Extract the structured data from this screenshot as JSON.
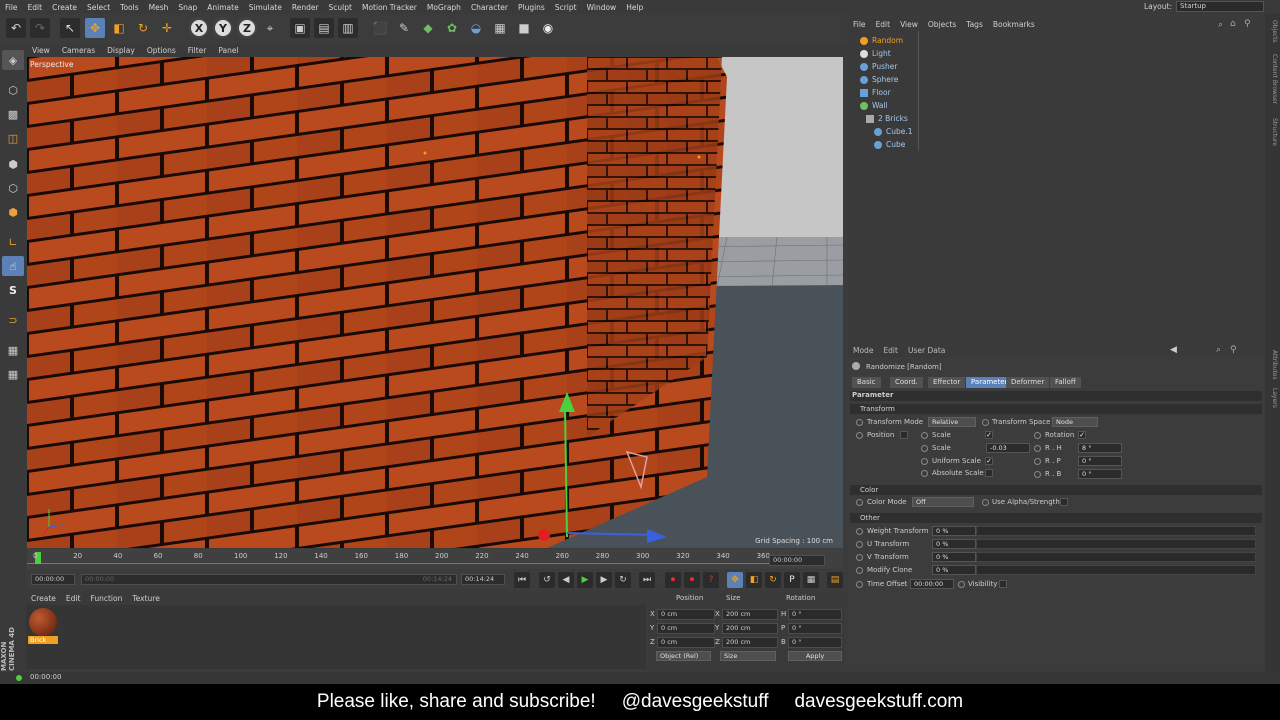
{
  "menubar": {
    "items": [
      "File",
      "Edit",
      "Create",
      "Select",
      "Tools",
      "Mesh",
      "Snap",
      "Animate",
      "Simulate",
      "Render",
      "Sculpt",
      "Motion Tracker",
      "MoGraph",
      "Character",
      "Plugins",
      "Script",
      "Window",
      "Help"
    ],
    "layout_label": "Layout:",
    "layout_value": "Startup"
  },
  "toolbar": {
    "axis_x": "X",
    "axis_y": "Y",
    "axis_z": "Z"
  },
  "viewport": {
    "menu": [
      "View",
      "Cameras",
      "Display",
      "Options",
      "Filter",
      "Panel"
    ],
    "camera_label": "Perspective",
    "grid_spacing": "Grid Spacing : 100 cm",
    "brick_color": "#b84a1e"
  },
  "timeline": {
    "ticks": [
      "0",
      "20",
      "40",
      "60",
      "80",
      "100",
      "120",
      "140",
      "160",
      "180",
      "200",
      "220",
      "240",
      "260",
      "280",
      "300",
      "320",
      "340",
      "360"
    ],
    "end_frame": "00:00:00",
    "current_time": "00:00:00",
    "range_start": "00:00:00",
    "range_end": "00:14:24",
    "max_time": "00:14:24"
  },
  "material_manager": {
    "menu": [
      "Create",
      "Edit",
      "Function",
      "Texture"
    ],
    "material_name": "Brick"
  },
  "coordinates": {
    "headers": [
      "Position",
      "Size",
      "Rotation"
    ],
    "rows": [
      {
        "axis": "X",
        "pos": "0 cm",
        "size_axis": "X",
        "size": "200 cm",
        "rot_axis": "H",
        "rot": "0 °"
      },
      {
        "axis": "Y",
        "pos": "0 cm",
        "size_axis": "Y",
        "size": "200 cm",
        "rot_axis": "P",
        "rot": "0 °"
      },
      {
        "axis": "Z",
        "pos": "0 cm",
        "size_axis": "Z",
        "size": "200 cm",
        "rot_axis": "B",
        "rot": "0 °"
      }
    ],
    "mode_select": "Object (Rel)",
    "size_select": "Size",
    "apply_label": "Apply"
  },
  "statusbar": {
    "time": "00:00:00"
  },
  "object_manager": {
    "menu": [
      "File",
      "Edit",
      "View",
      "Objects",
      "Tags",
      "Bookmarks"
    ],
    "objects": [
      {
        "name": "Random",
        "indent": 0,
        "selected": true
      },
      {
        "name": "Light",
        "indent": 0,
        "selected": false
      },
      {
        "name": "Pusher",
        "indent": 0,
        "selected": false
      },
      {
        "name": "Sphere",
        "indent": 0,
        "selected": false
      },
      {
        "name": "Floor",
        "indent": 0,
        "selected": false
      },
      {
        "name": "Wall",
        "indent": 0,
        "selected": false
      },
      {
        "name": "2 Bricks",
        "indent": 1,
        "selected": false
      },
      {
        "name": "Cube.1",
        "indent": 2,
        "selected": false
      },
      {
        "name": "Cube",
        "indent": 2,
        "selected": false
      }
    ]
  },
  "attributes": {
    "menu": [
      "Mode",
      "Edit",
      "User Data"
    ],
    "object_title": "Randomize [Random]",
    "tabs": [
      "Basic",
      "Coord.",
      "Effector",
      "Parameter",
      "Deformer",
      "Falloff"
    ],
    "active_tab": "Parameter",
    "section_parameter": "Parameter",
    "section_transform": "Transform",
    "transform_mode_label": "Transform Mode",
    "transform_mode_value": "Relative",
    "transform_space_label": "Transform Space",
    "transform_space_value": "Node",
    "position_label": "Position",
    "scale_label": "Scale",
    "rotation_label": "Rotation",
    "scale_value_label": "Scale",
    "scale_value": "-0.03",
    "rh_label": "R . H",
    "rh_value": "8 °",
    "rp_label": "R . P",
    "rp_value": "0 °",
    "rb_label": "R . B",
    "rb_value": "0 °",
    "uniform_scale_label": "Uniform Scale",
    "absolute_scale_label": "Absolute Scale",
    "section_color": "Color",
    "color_mode_label": "Color Mode",
    "color_mode_value": "Off",
    "use_alpha_label": "Use Alpha/Strength",
    "section_other": "Other",
    "weight_label": "Weight Transform",
    "weight_value": "0 %",
    "u_label": "U Transform",
    "u_value": "0 %",
    "v_label": "V Transform",
    "v_value": "0 %",
    "modify_label": "Modify Clone",
    "modify_value": "0 %",
    "time_offset_label": "Time Offset",
    "time_offset_value": "00:00:00",
    "visibility_label": "Visibility"
  },
  "side_tabs": [
    "Objects",
    "Content Browser",
    "Structure",
    "Attributes",
    "Layers"
  ],
  "caption": {
    "text1": "Please like, share and subscribe!",
    "text2": "@davesgeekstuff",
    "text3": "davesgeekstuff.com"
  }
}
